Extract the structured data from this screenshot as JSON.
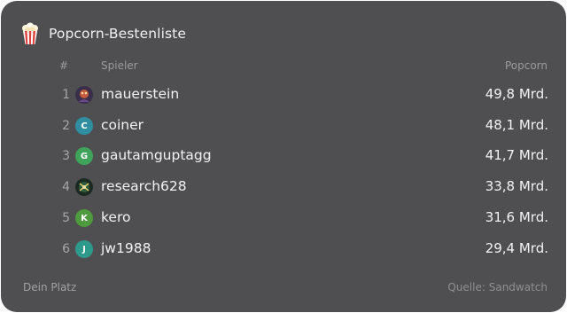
{
  "widget": {
    "title": "Popcorn-Bestenliste",
    "icon": "popcorn-icon"
  },
  "columns": {
    "rank": "#",
    "player": "Spieler",
    "popcorn": "Popcorn"
  },
  "rows": [
    {
      "rank": "1",
      "player": "mauerstein",
      "value": "49,8 Mrd.",
      "avatar_letter": "",
      "avatar_type": "image",
      "avatar_color": "#3a2f4a"
    },
    {
      "rank": "2",
      "player": "coiner",
      "value": "48,1 Mrd.",
      "avatar_letter": "C",
      "avatar_type": "letter",
      "avatar_color": "#2f8fa0"
    },
    {
      "rank": "3",
      "player": "gautamguptagg",
      "value": "41,7 Mrd.",
      "avatar_letter": "G",
      "avatar_type": "letter",
      "avatar_color": "#3fa45a"
    },
    {
      "rank": "4",
      "player": "research628",
      "value": "33,8 Mrd.",
      "avatar_letter": "",
      "avatar_type": "image",
      "avatar_color": "#1b2a22"
    },
    {
      "rank": "5",
      "player": "kero",
      "value": "31,6 Mrd.",
      "avatar_letter": "K",
      "avatar_type": "letter",
      "avatar_color": "#4f9a3e"
    },
    {
      "rank": "6",
      "player": "jw1988",
      "value": "29,4 Mrd.",
      "avatar_letter": "J",
      "avatar_type": "letter",
      "avatar_color": "#2e9a8c"
    }
  ],
  "footer": {
    "left": "Dein Platz",
    "right": "Quelle: Sandwatch"
  },
  "colors": {
    "card_bg": "#4f4f51",
    "text_primary": "#f2f2f2",
    "text_muted": "#9a9a9c"
  }
}
